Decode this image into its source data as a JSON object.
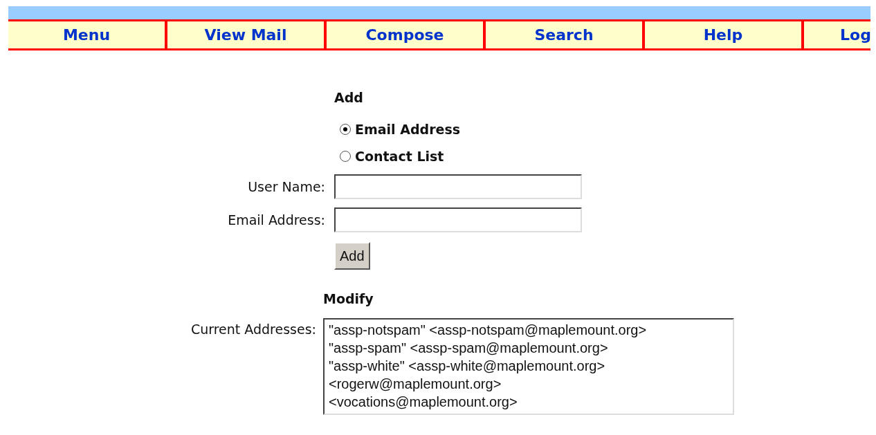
{
  "nav": [
    {
      "label": "Menu"
    },
    {
      "label": "View Mail"
    },
    {
      "label": "Compose"
    },
    {
      "label": "Search"
    },
    {
      "label": "Help"
    },
    {
      "label": "Log"
    }
  ],
  "add": {
    "heading": "Add",
    "options": [
      {
        "label": "Email Address",
        "selected": true
      },
      {
        "label": "Contact List",
        "selected": false
      }
    ],
    "fields": [
      {
        "label": "User Name:"
      },
      {
        "label": "Email Address:"
      }
    ],
    "button": "Add"
  },
  "modify": {
    "heading": "Modify",
    "label": "Current Addresses:",
    "addresses": [
      {
        "text": "\"assp-notspam\" <assp-notspam@maplemount.org>"
      },
      {
        "text": "\"assp-spam\" <assp-spam@maplemount.org>"
      },
      {
        "text": "\"assp-white\" <assp-white@maplemount.org>"
      },
      {
        "text": "<rogerw@maplemount.org>"
      },
      {
        "text": "<vocations@maplemount.org>"
      }
    ]
  }
}
